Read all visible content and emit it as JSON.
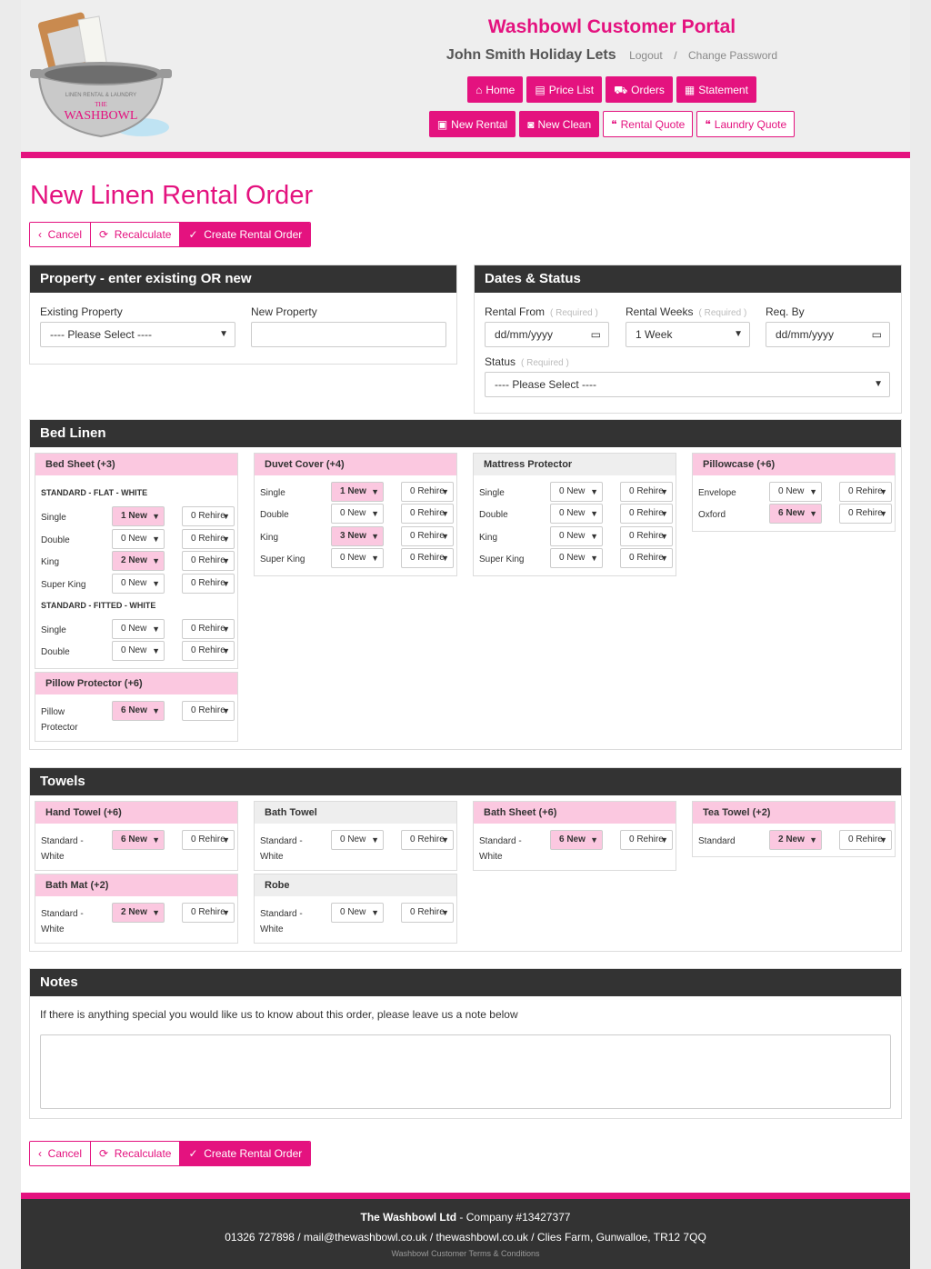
{
  "header": {
    "portal_title": "Washbowl Customer Portal",
    "user_name": "John Smith Holiday Lets",
    "logout": "Logout",
    "separator": "/",
    "change_password": "Change Password",
    "logo_top_text": "LINEN RENTAL & LAUNDRY",
    "logo_the": "THE",
    "logo_name": "WASHBOWL",
    "nav_primary": [
      "Home",
      "Price List",
      "Orders",
      "Statement"
    ],
    "nav_secondary": [
      "New Rental",
      "New Clean",
      "Rental Quote",
      "Laundry Quote"
    ]
  },
  "page_title": "New Linen Rental Order",
  "actions": {
    "cancel": "Cancel",
    "recalculate": "Recalculate",
    "create": "Create Rental Order"
  },
  "property": {
    "heading": "Property - enter existing OR new",
    "existing_label": "Existing Property",
    "existing_value": "---- Please Select ----",
    "new_label": "New Property",
    "new_value": ""
  },
  "dates": {
    "heading": "Dates & Status",
    "rental_from_label": "Rental From",
    "required": "( Required )",
    "rental_from_value": "dd/mm/yyyy",
    "rental_weeks_label": "Rental Weeks",
    "rental_weeks_value": "1 Week",
    "req_by_label": "Req. By",
    "req_by_value": "dd/mm/yyyy",
    "status_label": "Status",
    "status_value": "---- Please Select ----"
  },
  "bed_linen": {
    "heading": "Bed Linen",
    "bed_sheet": {
      "title": "Bed Sheet (+3)",
      "group1": "STANDARD - FLAT - WHITE",
      "group1_rows": [
        {
          "label": "Single",
          "new": "1 New",
          "rehire": "0 Rehire"
        },
        {
          "label": "Double",
          "new": "0 New",
          "rehire": "0 Rehire"
        },
        {
          "label": "King",
          "new": "2 New",
          "rehire": "0 Rehire"
        },
        {
          "label": "Super King",
          "new": "0 New",
          "rehire": "0 Rehire"
        }
      ],
      "group2": "STANDARD - FITTED - WHITE",
      "group2_rows": [
        {
          "label": "Single",
          "new": "0 New",
          "rehire": "0 Rehire"
        },
        {
          "label": "Double",
          "new": "0 New",
          "rehire": "0 Rehire"
        }
      ]
    },
    "pillow_protector": {
      "title": "Pillow Protector (+6)",
      "rows": [
        {
          "label": "Pillow Protector",
          "new": "6 New",
          "rehire": "0 Rehire"
        }
      ]
    },
    "duvet_cover": {
      "title": "Duvet Cover (+4)",
      "rows": [
        {
          "label": "Single",
          "new": "1 New",
          "rehire": "0 Rehire"
        },
        {
          "label": "Double",
          "new": "0 New",
          "rehire": "0 Rehire"
        },
        {
          "label": "King",
          "new": "3 New",
          "rehire": "0 Rehire"
        },
        {
          "label": "Super King",
          "new": "0 New",
          "rehire": "0 Rehire"
        }
      ]
    },
    "mattress_protector": {
      "title": "Mattress Protector",
      "rows": [
        {
          "label": "Single",
          "new": "0 New",
          "rehire": "0 Rehire"
        },
        {
          "label": "Double",
          "new": "0 New",
          "rehire": "0 Rehire"
        },
        {
          "label": "King",
          "new": "0 New",
          "rehire": "0 Rehire"
        },
        {
          "label": "Super King",
          "new": "0 New",
          "rehire": "0 Rehire"
        }
      ]
    },
    "pillowcase": {
      "title": "Pillowcase (+6)",
      "rows": [
        {
          "label": "Envelope",
          "new": "0 New",
          "rehire": "0 Rehire"
        },
        {
          "label": "Oxford",
          "new": "6 New",
          "rehire": "0 Rehire"
        }
      ]
    }
  },
  "towels": {
    "heading": "Towels",
    "hand_towel": {
      "title": "Hand Towel (+6)",
      "rows": [
        {
          "label": "Standard - White",
          "new": "6 New",
          "rehire": "0 Rehire"
        }
      ]
    },
    "bath_towel": {
      "title": "Bath Towel",
      "rows": [
        {
          "label": "Standard - White",
          "new": "0 New",
          "rehire": "0 Rehire"
        }
      ]
    },
    "bath_sheet": {
      "title": "Bath Sheet (+6)",
      "rows": [
        {
          "label": "Standard - White",
          "new": "6 New",
          "rehire": "0 Rehire"
        }
      ]
    },
    "tea_towel": {
      "title": "Tea Towel (+2)",
      "rows": [
        {
          "label": "Standard",
          "new": "2 New",
          "rehire": "0 Rehire"
        }
      ]
    },
    "bath_mat": {
      "title": "Bath Mat (+2)",
      "rows": [
        {
          "label": "Standard - White",
          "new": "2 New",
          "rehire": "0 Rehire"
        }
      ]
    },
    "robe": {
      "title": "Robe",
      "rows": [
        {
          "label": "Standard - White",
          "new": "0 New",
          "rehire": "0 Rehire"
        }
      ]
    }
  },
  "notes": {
    "heading": "Notes",
    "prompt": "If there is anything special you would like us to know about this order, please leave us a note below",
    "value": ""
  },
  "footer": {
    "company_name": "The Washbowl Ltd",
    "company_no": " - Company #13427377",
    "contact": "01326 727898 / mail@thewashbowl.co.uk / thewashbowl.co.uk / Clies Farm, Gunwalloe, TR12 7QQ",
    "terms": "Washbowl Customer Terms & Conditions"
  },
  "colors": {
    "accent": "#e4127f",
    "accent_light": "#fbc8e0",
    "panel_head": "#333333"
  }
}
